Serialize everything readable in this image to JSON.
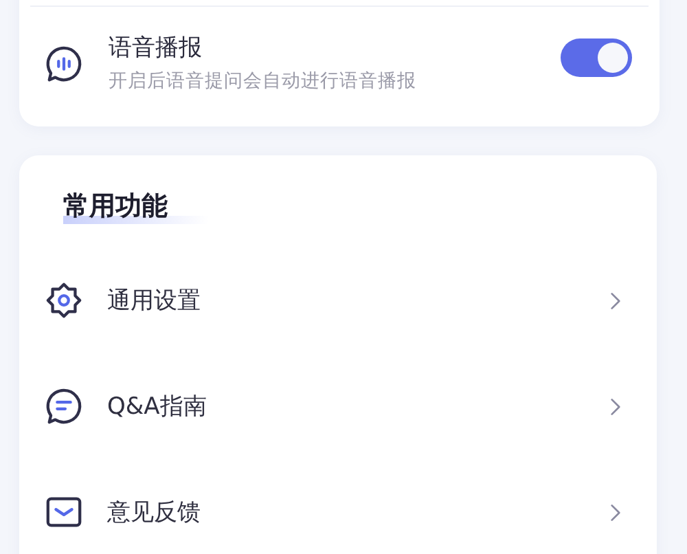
{
  "voice_broadcast": {
    "title": "语音播报",
    "description": "开启后语音提问会自动进行语音播报",
    "on": true
  },
  "common_functions": {
    "heading": "常用功能",
    "items": [
      {
        "label": "通用设置",
        "kind": "gear"
      },
      {
        "label": "Q&A指南",
        "kind": "chat"
      },
      {
        "label": "意见反馈",
        "kind": "mail"
      }
    ]
  }
}
